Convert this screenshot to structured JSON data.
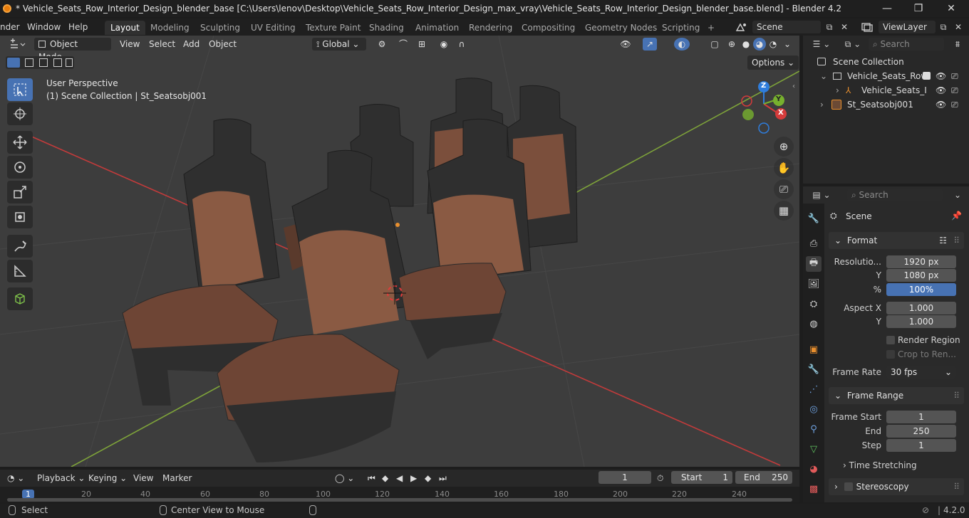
{
  "window": {
    "title": "* Vehicle_Seats_Row_Interior_Design_blender_base [C:\\Users\\lenov\\Desktop\\Vehicle_Seats_Row_Interior_Design_max_vray\\Vehicle_Seats_Row_Interior_Design_blender_base.blend] - Blender 4.2",
    "minimize": "—",
    "maximize": "❐",
    "close": "✕"
  },
  "menu": {
    "render": "nder",
    "window": "Window",
    "help": "Help"
  },
  "workspaces": [
    "Layout",
    "Modeling",
    "Sculpting",
    "UV Editing",
    "Texture Paint",
    "Shading",
    "Animation",
    "Rendering",
    "Compositing",
    "Geometry Nodes",
    "Scripting"
  ],
  "add_workspace": "+",
  "scene_field": "Scene",
  "viewlayer_field": "ViewLayer",
  "viewport": {
    "mode": "Object Mode",
    "menus": [
      "View",
      "Select",
      "Add",
      "Object"
    ],
    "orientation": "Global",
    "options": "Options",
    "perspective": "User Perspective",
    "collection_info": "(1) Scene Collection | St_Seatsobj001",
    "gizmo": {
      "x": "X",
      "y": "Y",
      "z": "Z"
    }
  },
  "outliner": {
    "search_placeholder": "Search",
    "root": "Scene Collection",
    "rows": [
      "Vehicle_Seats_Row",
      "Vehicle_Seats_I",
      "St_Seatsobj001"
    ]
  },
  "properties": {
    "search_placeholder": "Search",
    "context": "Scene",
    "format": {
      "header": "Format",
      "resolution_label": "Resolutio...",
      "resolution_x": "1920 px",
      "y_label": "Y",
      "resolution_y": "1080 px",
      "percent_label": "%",
      "percent": "100%",
      "aspect_x_label": "Aspect X",
      "aspect_x": "1.000",
      "aspect_y_label": "Y",
      "aspect_y": "1.000",
      "render_region": "Render Region",
      "crop": "Crop to Ren...",
      "frame_rate_label": "Frame Rate",
      "frame_rate": "30 fps"
    },
    "frame_range": {
      "header": "Frame Range",
      "start_label": "Frame Start",
      "start": "1",
      "end_label": "End",
      "end": "250",
      "step_label": "Step",
      "step": "1",
      "time_stretching": "Time Stretching"
    },
    "stereoscopy": "Stereoscopy"
  },
  "timeline": {
    "menus": [
      "Playback",
      "Keying",
      "View",
      "Marker"
    ],
    "current_frame": "1",
    "start_label": "Start",
    "start": "1",
    "end_label": "End",
    "end": "250",
    "ticks": [
      "1",
      "20",
      "40",
      "60",
      "80",
      "100",
      "120",
      "140",
      "160",
      "180",
      "200",
      "220",
      "240"
    ]
  },
  "statusbar": {
    "select": "Select",
    "center_view": "Center View to Mouse",
    "version": "4.2.0"
  },
  "colors": {
    "accent": "#4772b3",
    "viewport_bg": "#3d3d3d",
    "seat_leather_brown": "#8a5a43",
    "seat_dark": "#2e2e2e",
    "axis_x": "#c33b3b",
    "axis_y": "#7ea33a"
  }
}
